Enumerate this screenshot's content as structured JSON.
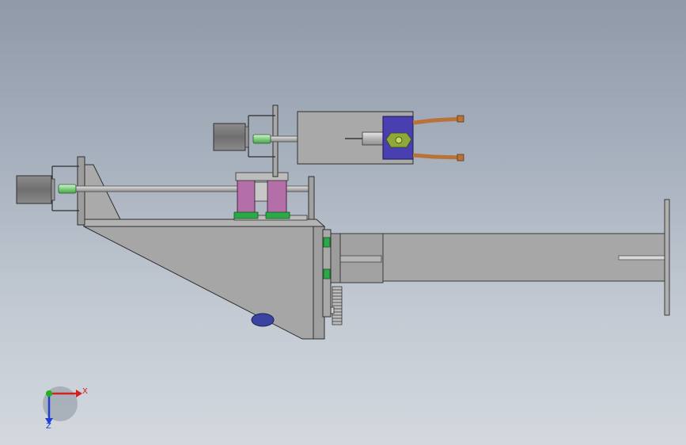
{
  "viewport": {
    "background_top": "#8f9aa8",
    "background_bottom": "#d3d8de"
  },
  "triad": {
    "x_label": "X",
    "z_label": "Z",
    "x_color": "#d42020",
    "y_color": "#1fb41f",
    "z_color": "#1f3fd4"
  },
  "model": {
    "steel_color": "#a3a3a3",
    "motor_color": "#7a7a7a",
    "bracket_color": "#b56fa8",
    "pad_color": "#2aa84a",
    "jaw_color": "#b8733a",
    "clamp_color": "#4a3fb0"
  }
}
